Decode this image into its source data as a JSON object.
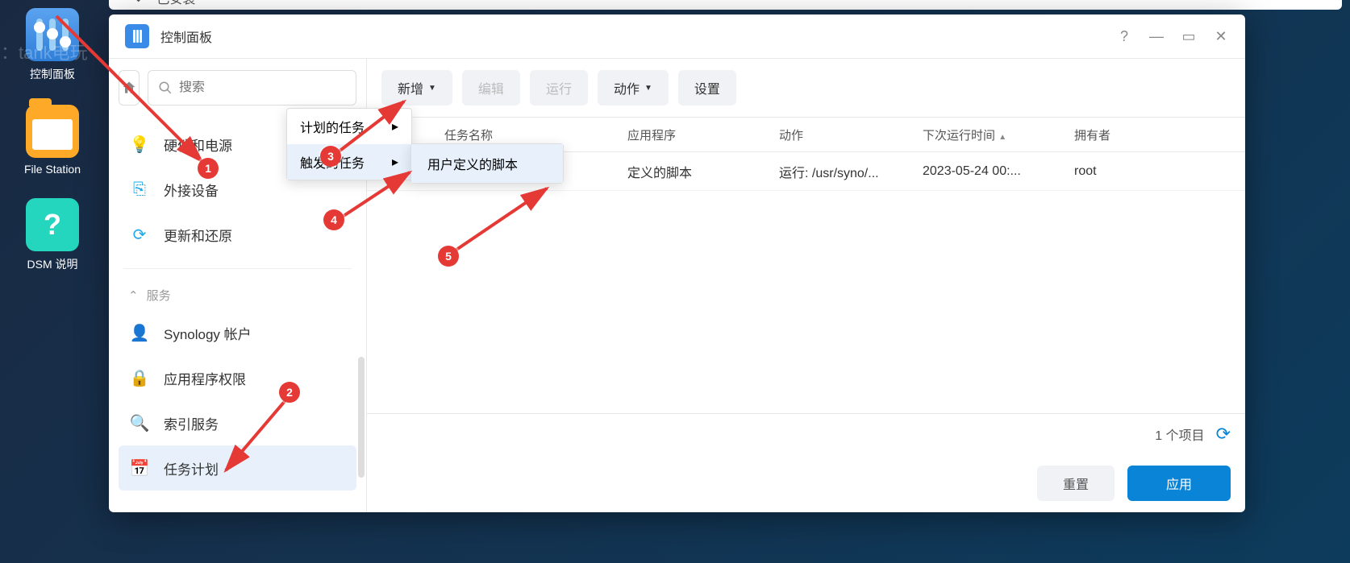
{
  "watermark": "淘宝店：tank电玩",
  "desktop": {
    "items": [
      {
        "label": "控制面板"
      },
      {
        "label": "File Station"
      },
      {
        "label": "DSM 说明"
      }
    ]
  },
  "bg_window": {
    "installed": "已安装"
  },
  "window": {
    "title": "控制面板"
  },
  "sidebar": {
    "search_placeholder": "搜索",
    "items": [
      {
        "label": "硬件和电源",
        "color": "#f5a623"
      },
      {
        "label": "外接设备",
        "color": "#1fa9e8"
      },
      {
        "label": "更新和还原",
        "color": "#1fa9e8"
      }
    ],
    "section": "服务",
    "items2": [
      {
        "label": "Synology 帐户",
        "color": "#1fa9e8"
      },
      {
        "label": "应用程序权限",
        "color": "#f5a623"
      },
      {
        "label": "索引服务",
        "color": "#14c0a8"
      },
      {
        "label": "任务计划",
        "color": "#e56b6b"
      }
    ]
  },
  "toolbar": {
    "add": "新增",
    "edit": "编辑",
    "run": "运行",
    "action": "动作",
    "settings": "设置"
  },
  "table": {
    "headers": {
      "enabled": "",
      "name": "任务名称",
      "app": "应用程序",
      "act": "动作",
      "next": "下次运行时间",
      "owner": "拥有者"
    },
    "sort_indicator": "▲",
    "rows": [
      {
        "name": "",
        "app": "定义的脚本",
        "act": "运行: /usr/syno/...",
        "next": "2023-05-24 00:...",
        "owner": "root"
      }
    ]
  },
  "menu": {
    "scheduled": "计划的任务",
    "triggered": "触发的任务",
    "user_script": "用户定义的脚本"
  },
  "footer": {
    "count": "1 个项目",
    "reset": "重置",
    "apply": "应用"
  },
  "annotations": {
    "b1": "1",
    "b2": "2",
    "b3": "3",
    "b4": "4",
    "b5": "5"
  }
}
